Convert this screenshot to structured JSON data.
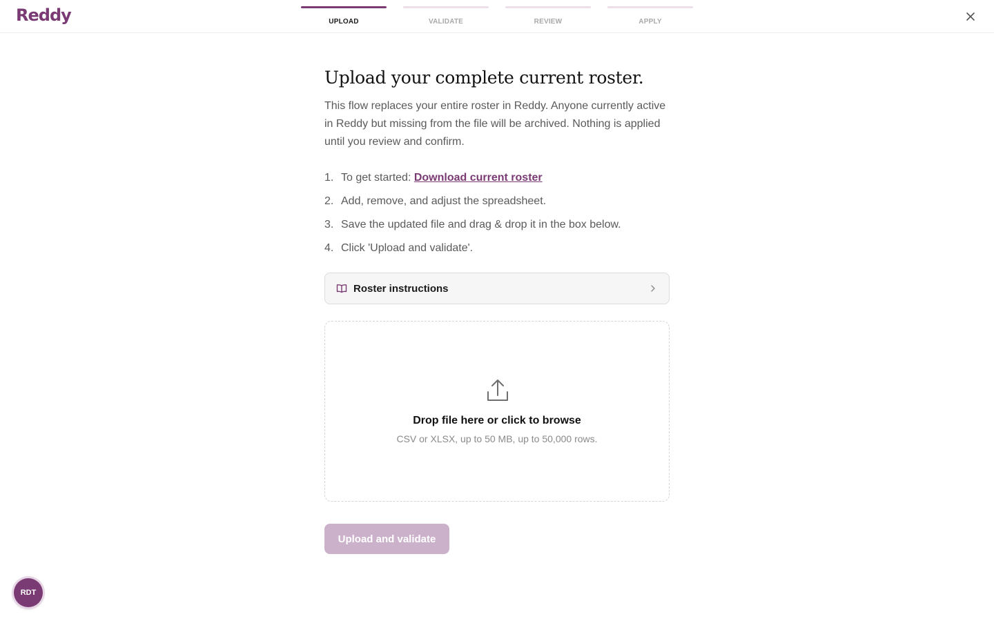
{
  "header": {
    "logo": "Reddy",
    "steps": [
      {
        "label": "UPLOAD",
        "active": true
      },
      {
        "label": "VALIDATE",
        "active": false
      },
      {
        "label": "REVIEW",
        "active": false
      },
      {
        "label": "APPLY",
        "active": false
      }
    ],
    "close_icon": "close-icon"
  },
  "main": {
    "title": "Upload your complete current roster.",
    "description": "This flow replaces your entire roster in Reddy. Anyone currently active in Reddy but missing from the file will be archived. Nothing is applied until you review and confirm.",
    "instructions": [
      {
        "number": "1.",
        "text": "To get started: ",
        "link": "Download current roster"
      },
      {
        "number": "2.",
        "text": "Add, remove, and adjust the spreadsheet."
      },
      {
        "number": "3.",
        "text": "Save the updated file and drag & drop it in the box below."
      },
      {
        "number": "4.",
        "text": "Click 'Upload and validate'."
      }
    ],
    "roster_instructions": {
      "label": "Roster instructions",
      "icon": "book-icon",
      "chevron": "chevron-right-icon"
    },
    "dropzone": {
      "icon": "upload-icon",
      "title": "Drop file here or click to browse",
      "subtitle": "CSV or XLSX, up to 50 MB, up to 50,000 rows."
    },
    "submit_label": "Upload and validate"
  },
  "avatar": {
    "initials": "RDT"
  },
  "colors": {
    "brand": "#7a3a73",
    "brand_light": "#ecdfea",
    "button_disabled": "#cbb2ca"
  }
}
